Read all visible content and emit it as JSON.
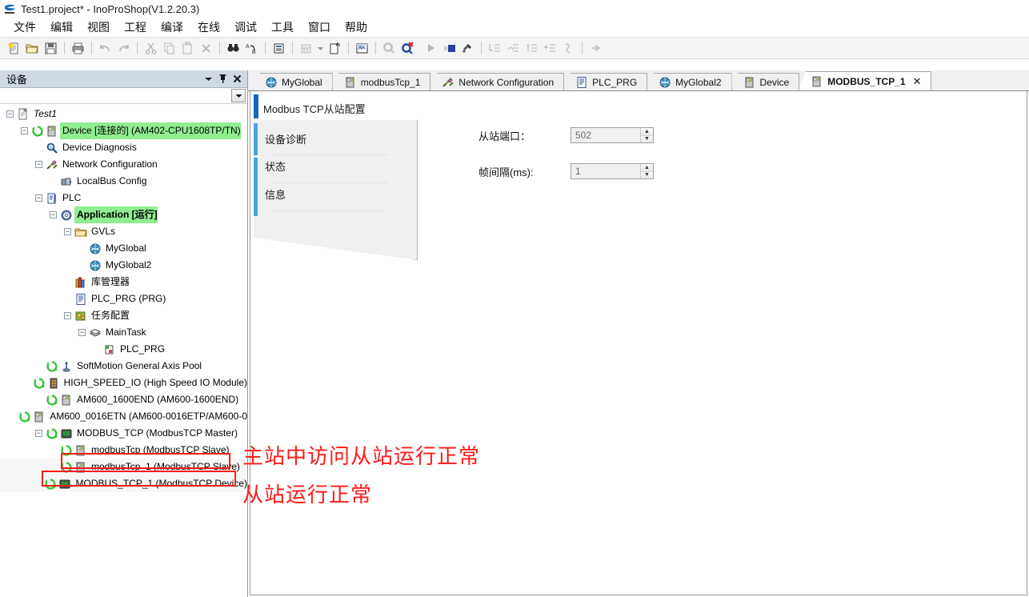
{
  "window": {
    "title": "Test1.project* - InoProShop(V1.2.20.3)",
    "app_icon": "inovance-logo-icon"
  },
  "menu": {
    "items": [
      "文件",
      "编辑",
      "视图",
      "工程",
      "编译",
      "在线",
      "调试",
      "工具",
      "窗口",
      "帮助"
    ]
  },
  "toolbar": {
    "groups": [
      [
        "new-file-icon",
        "open-folder-icon",
        "save-icon"
      ],
      [
        "print-icon"
      ],
      [
        "undo-icon",
        "redo-icon"
      ],
      [
        "cut-icon",
        "copy-icon",
        "paste-icon",
        "delete-icon"
      ],
      [
        "find-icon",
        "replace-icon"
      ],
      [
        "paste-list-icon"
      ],
      [
        "build-icon",
        "build-dropdown-icon"
      ],
      [
        "generate-code-icon"
      ],
      [
        "login-icon"
      ],
      [
        "online-change-icon",
        "logout-icon"
      ],
      [
        "run-icon",
        "stop-icon",
        "reset-icon"
      ],
      [
        "step-into-icon",
        "step-over-icon",
        "step-out-icon",
        "run-to-cursor-icon",
        "set-next-statement-icon"
      ],
      [
        "next-instruction-icon"
      ]
    ]
  },
  "devices_panel": {
    "header_title": "设备",
    "header_buttons": [
      "menu-dropdown-icon",
      "pin-icon",
      "close-icon"
    ],
    "combo_value": "",
    "tree": [
      {
        "label": "Test1",
        "depth": 0,
        "icon": "project-icon",
        "expander": "-",
        "style": "italic"
      },
      {
        "label": "Device [连接的] (AM402-CPU1608TP/TN)",
        "depth": 1,
        "icon": "plc-device-icon",
        "expander": "-",
        "status": "connected-icon",
        "selected": true
      },
      {
        "label": "Device Diagnosis",
        "depth": 2,
        "icon": "magnifier-icon",
        "expander": ""
      },
      {
        "label": "Network Configuration",
        "depth": 2,
        "icon": "network-config-icon",
        "expander": "-"
      },
      {
        "label": "LocalBus Config",
        "depth": 3,
        "icon": "localbus-icon",
        "expander": ""
      },
      {
        "label": "PLC",
        "depth": 2,
        "icon": "plc-logic-icon",
        "expander": "-"
      },
      {
        "label": "Application [运行]",
        "depth": 3,
        "icon": "application-icon",
        "expander": "-",
        "selected": true,
        "style": "bold"
      },
      {
        "label": "GVLs",
        "depth": 4,
        "icon": "folder-icon",
        "expander": "-"
      },
      {
        "label": "MyGlobal",
        "depth": 5,
        "icon": "gvl-globe-icon",
        "expander": ""
      },
      {
        "label": "MyGlobal2",
        "depth": 5,
        "icon": "gvl-globe-icon",
        "expander": ""
      },
      {
        "label": "库管理器",
        "depth": 4,
        "icon": "library-manager-icon",
        "expander": ""
      },
      {
        "label": "PLC_PRG (PRG)",
        "depth": 4,
        "icon": "program-icon",
        "expander": ""
      },
      {
        "label": "任务配置",
        "depth": 4,
        "icon": "task-config-icon",
        "expander": "-"
      },
      {
        "label": "MainTask",
        "depth": 5,
        "icon": "task-icon",
        "expander": "-"
      },
      {
        "label": "PLC_PRG",
        "depth": 6,
        "icon": "task-call-icon",
        "expander": ""
      },
      {
        "label": "SoftMotion General Axis Pool",
        "depth": 2,
        "icon": "axis-pool-icon",
        "expander": "",
        "status": "connected-icon"
      },
      {
        "label": "HIGH_SPEED_IO (High Speed IO Module)",
        "depth": 2,
        "icon": "io-module-icon",
        "expander": "",
        "status": "connected-icon"
      },
      {
        "label": "AM600_1600END (AM600-1600END)",
        "depth": 2,
        "icon": "module-icon",
        "expander": "",
        "status": "connected-icon"
      },
      {
        "label": "AM600_0016ETN (AM600-0016ETP/AM600-0",
        "depth": 2,
        "icon": "module-icon",
        "expander": "",
        "status": "connected-icon"
      },
      {
        "label": "MODBUS_TCP (ModbusTCP Master)",
        "depth": 2,
        "icon": "ethernet-device-icon",
        "expander": "-",
        "status": "connected-icon"
      },
      {
        "label": "modbusTcp (ModbusTCP Slave)",
        "depth": 3,
        "icon": "module-icon",
        "expander": "",
        "status": "connected-icon"
      },
      {
        "label": "modbusTcp_1 (ModbusTCP Slave)",
        "depth": 3,
        "icon": "module-icon",
        "expander": "",
        "status": "connected-icon",
        "highlight": true
      },
      {
        "label": "MODBUS_TCP_1 (ModbusTCP Device)",
        "depth": 2,
        "icon": "ethernet-device-icon",
        "expander": "",
        "status": "connected-icon",
        "highlight": true
      }
    ]
  },
  "editor": {
    "tabs": [
      {
        "label": "MyGlobal",
        "icon": "gvl-globe-icon",
        "active": false,
        "closable": false
      },
      {
        "label": "modbusTcp_1",
        "icon": "module-icon",
        "active": false,
        "closable": false
      },
      {
        "label": "Network Configuration",
        "icon": "network-config-icon",
        "active": false,
        "closable": false
      },
      {
        "label": "PLC_PRG",
        "icon": "program-icon",
        "active": false,
        "closable": false
      },
      {
        "label": "MyGlobal2",
        "icon": "gvl-globe-icon",
        "active": false,
        "closable": false
      },
      {
        "label": "Device",
        "icon": "plc-device-icon",
        "active": false,
        "closable": false
      },
      {
        "label": "MODBUS_TCP_1",
        "icon": "module-icon",
        "active": true,
        "closable": true,
        "close_label": "✕"
      }
    ],
    "page_title": "Modbus TCP从站配置",
    "side_tabs": [
      {
        "label": "设备诊断",
        "active": false
      },
      {
        "label": "状态",
        "active": false
      },
      {
        "label": "信息",
        "active": false
      }
    ],
    "fields": [
      {
        "label": "从站端口：",
        "value": "502",
        "name": "slave-port"
      },
      {
        "label": "帧间隔(ms):",
        "value": "1",
        "name": "frame-interval"
      }
    ]
  },
  "annotations": [
    {
      "text": "主站中访问从站运行正常",
      "name": "annotation-master-access"
    },
    {
      "text": "从站运行正常",
      "name": "annotation-slave-running"
    }
  ],
  "colors": {
    "accent_active_tab": "#1565c0",
    "accent_inactive_tab": "#4fa3e3",
    "selection_green": "#90ee90",
    "annotation_red": "#ff1a1a",
    "panel_header": "#cfd9e3"
  }
}
